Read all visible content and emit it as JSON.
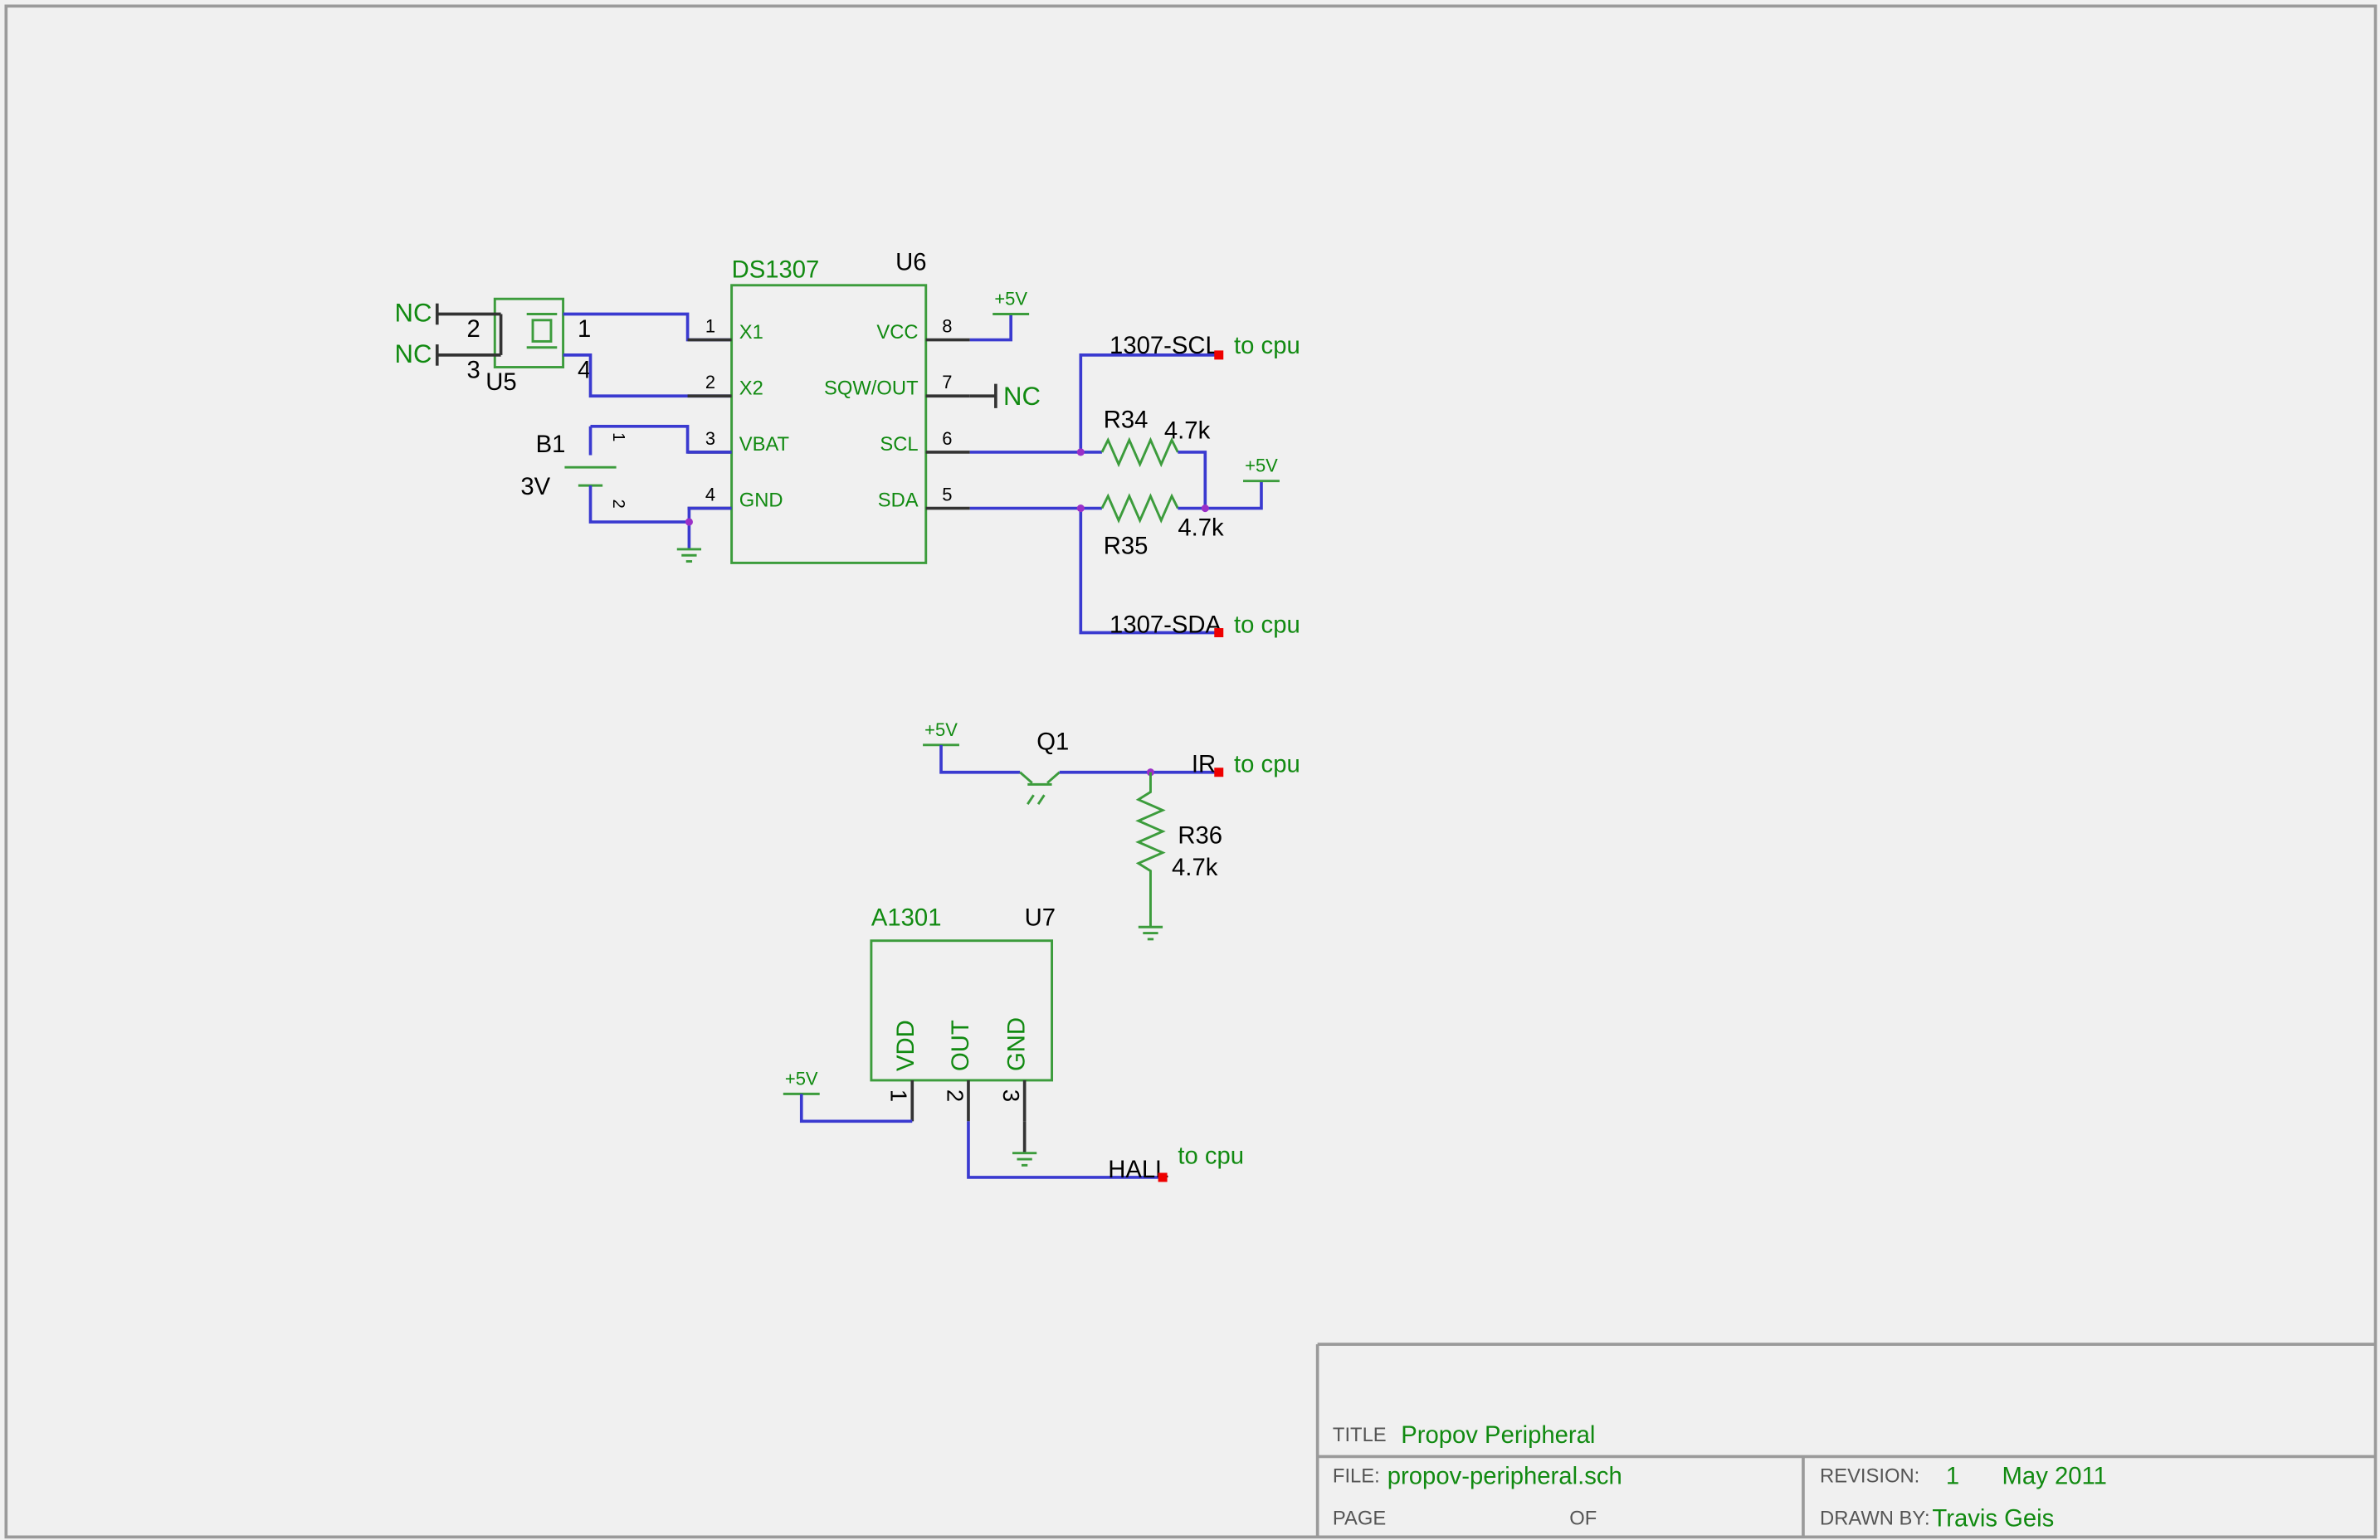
{
  "u6": {
    "part": "DS1307",
    "ref": "U6",
    "pins": [
      {
        "num": "1",
        "name": "X1"
      },
      {
        "num": "2",
        "name": "X2"
      },
      {
        "num": "3",
        "name": "VBAT"
      },
      {
        "num": "4",
        "name": "GND"
      },
      {
        "num": "8",
        "name": "VCC"
      },
      {
        "num": "7",
        "name": "SQW/OUT"
      },
      {
        "num": "6",
        "name": "SCL"
      },
      {
        "num": "5",
        "name": "SDA"
      }
    ]
  },
  "u5": {
    "ref": "U5",
    "pin1": "1",
    "pin2": "2",
    "pin3": "3",
    "pin4": "4",
    "nc1": "NC",
    "nc2": "NC"
  },
  "b1": {
    "ref": "B1",
    "value": "3V",
    "pin1": "1",
    "pin2": "2"
  },
  "sqw_nc": "NC",
  "r34": {
    "ref": "R34",
    "value": "4.7k"
  },
  "r35": {
    "ref": "R35",
    "value": "4.7k"
  },
  "r36": {
    "ref": "R36",
    "value": "4.7k"
  },
  "q1": {
    "ref": "Q1"
  },
  "u7": {
    "part": "A1301",
    "ref": "U7",
    "pins": [
      {
        "num": "1",
        "name": "VDD"
      },
      {
        "num": "2",
        "name": "OUT"
      },
      {
        "num": "3",
        "name": "GND"
      }
    ]
  },
  "power": {
    "vcc": "+5V"
  },
  "nets": {
    "scl": {
      "label": "1307-SCL",
      "note": "to cpu"
    },
    "sda": {
      "label": "1307-SDA",
      "note": "to cpu"
    },
    "ir": {
      "label": "IR",
      "note": "to cpu"
    },
    "hall": {
      "label": "HALL",
      "note": "to cpu"
    }
  },
  "title_block": {
    "title_label": "TITLE",
    "title": "Propov Peripheral",
    "file_label": "FILE:",
    "file": "propov-peripheral.sch",
    "revision_label": "REVISION:",
    "revision": "1",
    "date": "May 2011",
    "page_label": "PAGE",
    "of_label": "OF",
    "drawn_by_label": "DRAWN BY:",
    "drawn_by": "Travis Geis"
  },
  "colors": {
    "wire": "#3a3ad0",
    "symbol": "#3c9c3c",
    "label_green": "#118a11",
    "junction": "#9b30c8",
    "port": "#ee0000"
  }
}
